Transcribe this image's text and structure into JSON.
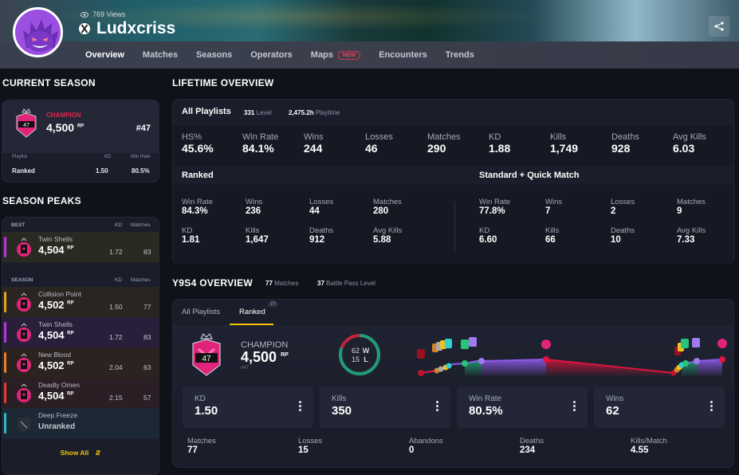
{
  "header": {
    "views": "769 Views",
    "username": "Ludxcriss",
    "platform_icon": "xbox-icon",
    "share_icon": "share-icon"
  },
  "nav": {
    "tabs": [
      {
        "label": "Overview",
        "active": true
      },
      {
        "label": "Matches"
      },
      {
        "label": "Seasons"
      },
      {
        "label": "Operators"
      },
      {
        "label": "Maps",
        "badge": "NEW"
      },
      {
        "label": "Encounters"
      },
      {
        "label": "Trends"
      }
    ]
  },
  "current_season": {
    "title": "CURRENT SEASON",
    "rank_name": "CHAMPION",
    "rank_number": "47",
    "rp": "4,500",
    "rp_unit": "RP",
    "position": "#47",
    "col_playlist": "Playlist",
    "col_kd": "KD",
    "col_winrate": "Win Rate",
    "playlist": "Ranked",
    "kd": "1.50",
    "winrate": "80.5%"
  },
  "season_peaks": {
    "title": "SEASON PEAKS",
    "best_label": "BEST",
    "season_label": "SEASON",
    "col_kd": "KD",
    "col_matches": "Matches",
    "best": {
      "name": "Twin Shells",
      "rp": "4,504",
      "kd": "1.72",
      "matches": "83",
      "color": "#b832e0"
    },
    "seasons": [
      {
        "name": "Collision Point",
        "rp": "4,502",
        "kd": "1.50",
        "matches": "77",
        "color": "#e8a21c",
        "bg": "#2a2520"
      },
      {
        "name": "Twin Shells",
        "rp": "4,504",
        "kd": "1.72",
        "matches": "83",
        "color": "#b832e0",
        "bg": "#2a1f3a"
      },
      {
        "name": "New Blood",
        "rp": "4,502",
        "kd": "2.04",
        "matches": "63",
        "color": "#f07c1e",
        "bg": "#2b2320"
      },
      {
        "name": "Deadly Omen",
        "rp": "4,504",
        "kd": "2.15",
        "matches": "57",
        "color": "#e83c2c",
        "bg": "#2b1e24"
      },
      {
        "name": "Deep Freeze",
        "rp": "Unranked",
        "kd": "",
        "matches": "",
        "color": "#2fb8c8",
        "bg": "#1c2834"
      }
    ],
    "show_all": "Show All"
  },
  "lifetime": {
    "title": "LIFETIME OVERVIEW",
    "all_playlists": "All Playlists",
    "level_value": "331",
    "level_label": "Level",
    "playtime_value": "2,475.2h",
    "playtime_label": "Playtime",
    "overall": [
      {
        "label": "HS%",
        "value": "45.6%"
      },
      {
        "label": "Win Rate",
        "value": "84.1%"
      },
      {
        "label": "Wins",
        "value": "244"
      },
      {
        "label": "Losses",
        "value": "46"
      },
      {
        "label": "Matches",
        "value": "290"
      },
      {
        "label": "KD",
        "value": "1.88"
      },
      {
        "label": "Kills",
        "value": "1,749"
      },
      {
        "label": "Deaths",
        "value": "928"
      },
      {
        "label": "Avg Kills",
        "value": "6.03"
      }
    ],
    "ranked_title": "Ranked",
    "ranked": [
      {
        "label": "Win Rate",
        "value": "84.3%"
      },
      {
        "label": "Wins",
        "value": "236"
      },
      {
        "label": "Losses",
        "value": "44"
      },
      {
        "label": "Matches",
        "value": "280"
      },
      {
        "label": "KD",
        "value": "1.81"
      },
      {
        "label": "Kills",
        "value": "1,647"
      },
      {
        "label": "Deaths",
        "value": "912"
      },
      {
        "label": "Avg Kills",
        "value": "5.88"
      }
    ],
    "standard_title": "Standard + Quick Match",
    "standard": [
      {
        "label": "Win Rate",
        "value": "77.8%"
      },
      {
        "label": "Wins",
        "value": "7"
      },
      {
        "label": "Losses",
        "value": "2"
      },
      {
        "label": "Matches",
        "value": "9"
      },
      {
        "label": "KD",
        "value": "6.60"
      },
      {
        "label": "Kills",
        "value": "66"
      },
      {
        "label": "Deaths",
        "value": "10"
      },
      {
        "label": "Avg Kills",
        "value": "7.33"
      }
    ]
  },
  "season_overview": {
    "title": "Y9S4 OVERVIEW",
    "matches_value": "77",
    "matches_label": "Matches",
    "bp_value": "37",
    "bp_label": "Battle Pass Level",
    "tabs": [
      {
        "label": "All Playlists"
      },
      {
        "label": "Ranked",
        "count": "77",
        "active": true
      }
    ],
    "rank_name": "CHAMPION",
    "rank_number": "47",
    "rp": "4,500",
    "rp_unit": "RP",
    "position": "#47",
    "wins": "62",
    "wins_label": "W",
    "losses": "15",
    "losses_label": "L",
    "win_fraction": 0.805,
    "cards": [
      {
        "label": "KD",
        "value": "1.50"
      },
      {
        "label": "Kills",
        "value": "350"
      },
      {
        "label": "Win Rate",
        "value": "80.5%"
      },
      {
        "label": "Wins",
        "value": "62"
      }
    ],
    "bottom": [
      {
        "label": "Matches",
        "value": "77"
      },
      {
        "label": "Losses",
        "value": "15"
      },
      {
        "label": "Abandons",
        "value": "0"
      },
      {
        "label": "Deaths",
        "value": "234"
      },
      {
        "label": "Kills/Match",
        "value": "4.55"
      }
    ]
  }
}
